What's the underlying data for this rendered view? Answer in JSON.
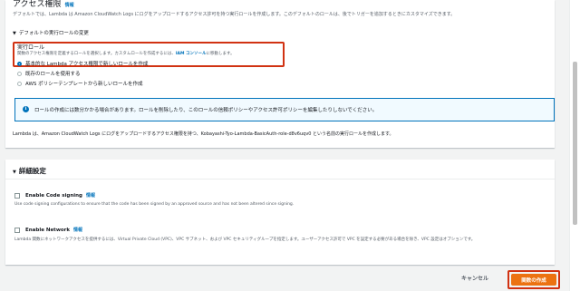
{
  "permissions": {
    "title": "アクセス権限",
    "info_link": "情報",
    "description": "デフォルトでは、Lambda は Amazon CloudWatch Logs にログをアップロードするアクセス許可を持つ実行ロールを作成します。このデフォルトのロールは、後でトリガーを追加するときにカスタマイズできます。",
    "expander_label": "デフォルトの実行ロールの変更",
    "execution_role_label": "実行ロール",
    "execution_role_desc_prefix": "関数のアクセス権限を定義するロールを選択します。カスタムロールを作成するには、",
    "iam_console_link": "IAM コンソール",
    "execution_role_desc_suffix": "に移動します。",
    "options": [
      {
        "label": "基本的な Lambda アクセス権限で新しいロールを作成",
        "selected": true
      },
      {
        "label": "既存のロールを使用する",
        "selected": false
      },
      {
        "label": "AWS ポリシーテンプレートから新しいロールを作成",
        "selected": false
      }
    ],
    "info_alert": "ロールの作成には数分かかる場合があります。ロールを削除したり、このロールの信頼ポリシーやアクセス許可ポリシーを編集したりしないでください。",
    "summary": "Lambda は、Amazon CloudWatch Logs にログをアップロードするアクセス権限を持つ、Kobayashi-Tyo-Lambda-BasicAuth-role-d8v6uqv0 という名前の実行ロールを作成します。"
  },
  "advanced": {
    "title": "詳細設定",
    "code_signing": {
      "label": "Enable Code signing",
      "info_link": "情報",
      "description": "Use code signing configurations to ensure that the code has been signed by an approved source and has not been altered since signing."
    },
    "network": {
      "label": "Enable Network",
      "info_link": "情報",
      "description": "Lambda 関数にネットワークアクセスを提供するには、Virtual Private Cloud (VPC)、VPC サブネット、および VPC セキュリティグループを指定します。ユーザーアクセス許可で VPC を設定する必要がある場合を除き、VPC 設定はオプションです。"
    }
  },
  "footer": {
    "cancel_label": "キャンセル",
    "create_label": "関数の作成"
  },
  "colors": {
    "primary_button": "#ec7211",
    "highlight_border": "#d13212",
    "link": "#0073bb"
  }
}
